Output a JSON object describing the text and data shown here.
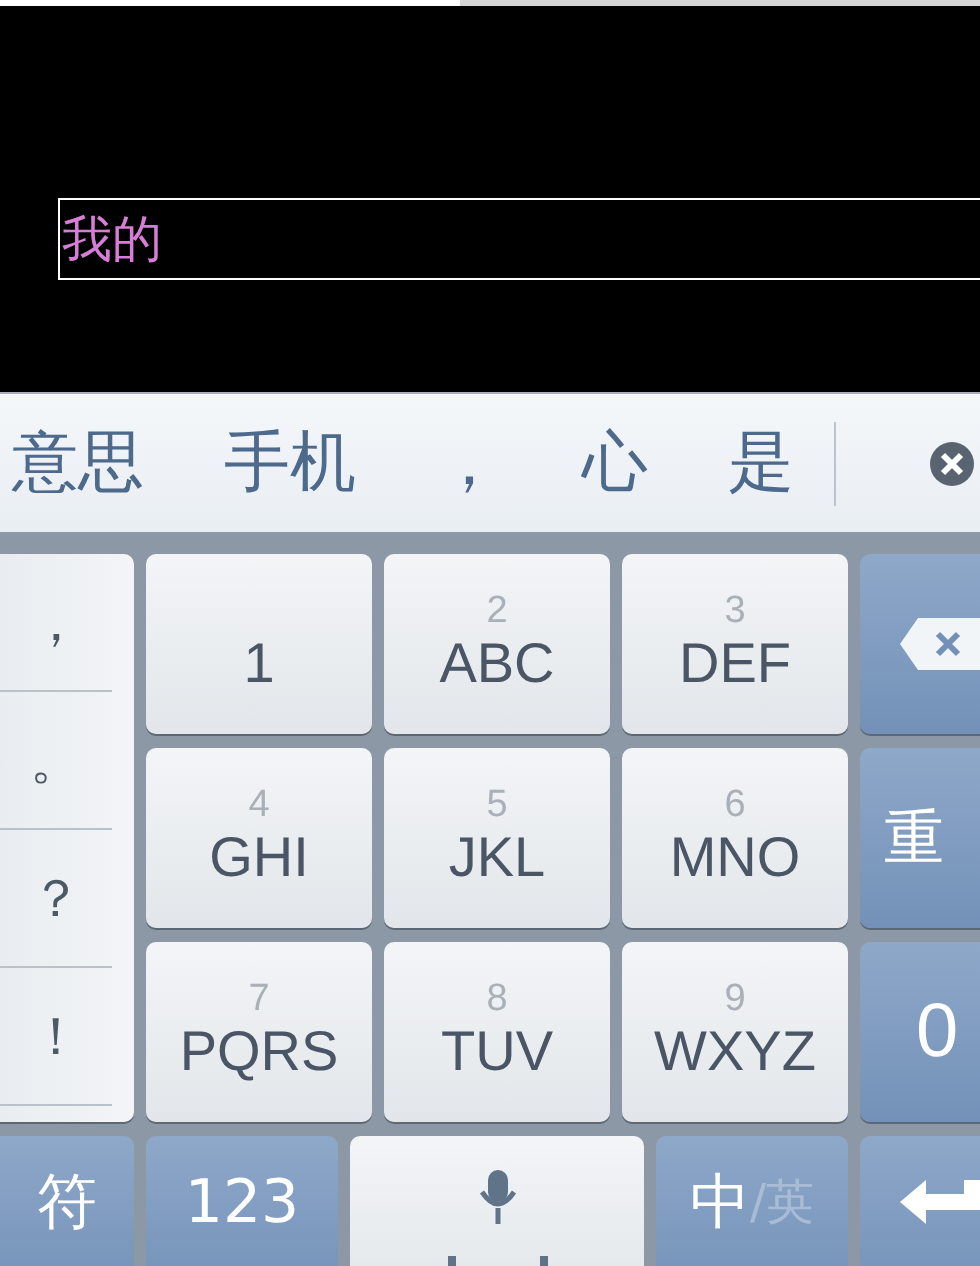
{
  "input": {
    "value": "我的"
  },
  "candidates": [
    "意思",
    "手机",
    "，",
    "心",
    "是"
  ],
  "punctuation": [
    "，",
    "。",
    "？",
    "！"
  ],
  "one_key": {
    "label": "1"
  },
  "keys": [
    {
      "number": "2",
      "letters": "ABC"
    },
    {
      "number": "3",
      "letters": "DEF"
    },
    {
      "number": "4",
      "letters": "GHI"
    },
    {
      "number": "5",
      "letters": "JKL"
    },
    {
      "number": "6",
      "letters": "MNO"
    },
    {
      "number": "7",
      "letters": "PQRS"
    },
    {
      "number": "8",
      "letters": "TUV"
    },
    {
      "number": "9",
      "letters": "WXYZ"
    }
  ],
  "side_keys": [
    {
      "kind": "backspace"
    },
    {
      "kind": "text",
      "label": "重"
    },
    {
      "kind": "text",
      "label": "0"
    }
  ],
  "bottom_keys": [
    {
      "kind": "text",
      "label": "符"
    },
    {
      "kind": "text",
      "label": "123"
    },
    {
      "kind": "space"
    },
    {
      "kind": "lang",
      "label": "中",
      "alt": "/英"
    },
    {
      "kind": "return"
    }
  ]
}
